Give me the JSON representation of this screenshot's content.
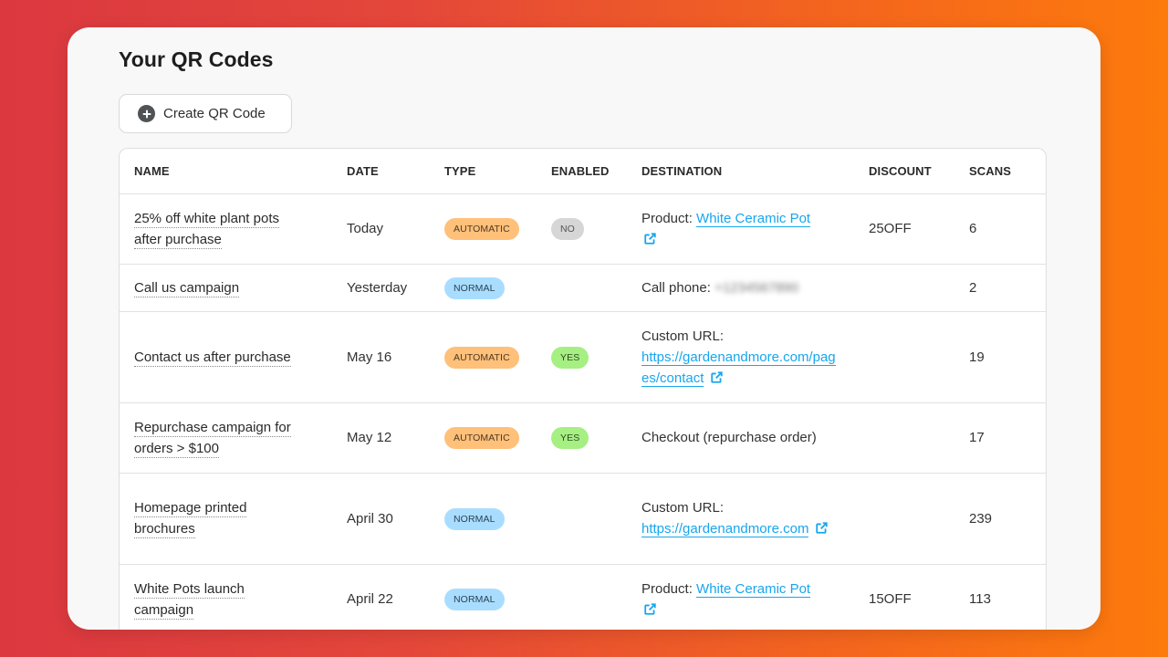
{
  "page": {
    "title": "Your QR Codes",
    "create_button": {
      "label": "Create QR Code",
      "icon": "plus-circle-icon"
    }
  },
  "colors": {
    "link": "#17a6ee",
    "automatic_pill": "#ffc07a",
    "normal_pill": "#a9ddff",
    "yes_pill": "#a6ef83",
    "no_pill": "#d6d6d6"
  },
  "table": {
    "columns": [
      "NAME",
      "DATE",
      "TYPE",
      "ENABLED",
      "DESTINATION",
      "DISCOUNT",
      "SCANS"
    ],
    "rows": [
      {
        "name": "25% off white plant pots after purchase",
        "date": "Today",
        "type": "AUTOMATIC",
        "enabled": "NO",
        "dest_prefix": "Product:",
        "dest_link": "White Ceramic Pot",
        "discount": "25OFF",
        "scans": "6"
      },
      {
        "name": "Call us campaign",
        "date": "Yesterday",
        "type": "NORMAL",
        "enabled": "",
        "dest_prefix": "Call phone:",
        "dest_value_blurred": "+1234567890",
        "discount": "",
        "scans": "2"
      },
      {
        "name": "Contact us after purchase",
        "date": "May 16",
        "type": "AUTOMATIC",
        "enabled": "YES",
        "dest_prefix": "Custom URL:",
        "dest_link": "https://gardenandmore.com/pages/contact",
        "discount": "",
        "scans": "19"
      },
      {
        "name": "Repurchase campaign for orders > $100",
        "date": "May 12",
        "type": "AUTOMATIC",
        "enabled": "YES",
        "dest_prefix": "Checkout (repurchase order)",
        "discount": "",
        "scans": "17"
      },
      {
        "name": "Homepage printed brochures",
        "date": "April 30",
        "type": "NORMAL",
        "enabled": "",
        "dest_prefix": "Custom URL:",
        "dest_link": "https://gardenandmore.com",
        "discount": "",
        "scans": "239"
      },
      {
        "name": "White Pots launch campaign",
        "date": "April 22",
        "type": "NORMAL",
        "enabled": "",
        "dest_prefix": "Product:",
        "dest_link": "White Ceramic Pot",
        "discount": "15OFF",
        "scans": "113"
      }
    ]
  }
}
